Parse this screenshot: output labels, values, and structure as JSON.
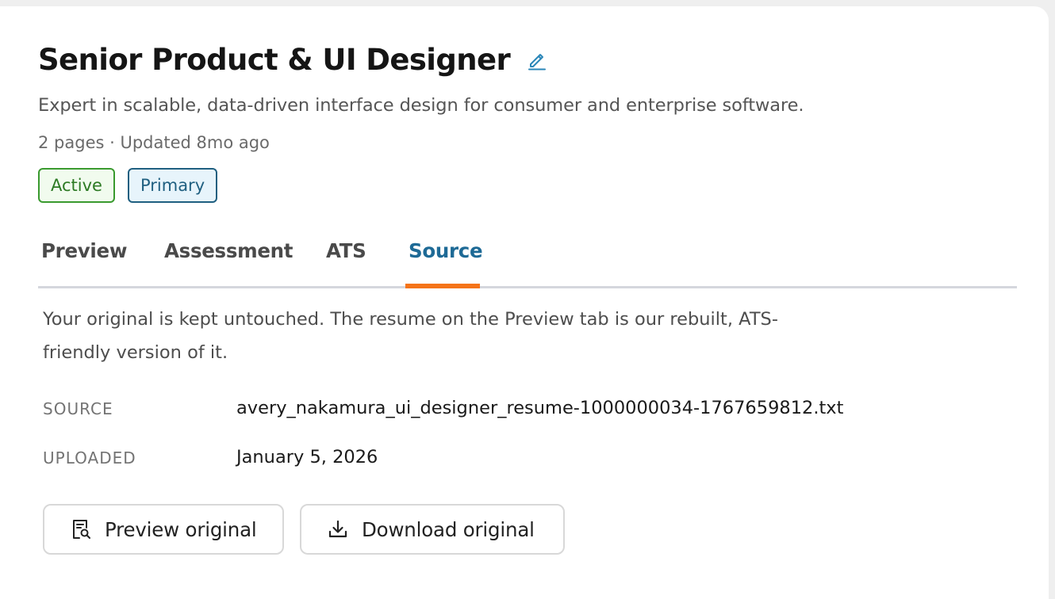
{
  "header": {
    "title": "Senior Product & UI Designer",
    "edit_icon": "pencil-icon",
    "subtitle": "Expert in scalable, data-driven interface design for consumer and enterprise software.",
    "meta": "2 pages · Updated 8mo ago"
  },
  "badges": {
    "active": "Active",
    "primary": "Primary"
  },
  "tabs": [
    {
      "label": "Preview",
      "active": false
    },
    {
      "label": "Assessment",
      "active": false
    },
    {
      "label": "ATS",
      "active": false
    },
    {
      "label": "Source",
      "active": true
    }
  ],
  "source_panel": {
    "description": "Your original is kept untouched. The resume on the Preview tab is our rebuilt, ATS-friendly version of it.",
    "source_label": "SOURCE",
    "source_value": "avery_nakamura_ui_designer_resume-1000000034-1767659812.txt",
    "uploaded_label": "UPLOADED",
    "uploaded_value": "January 5, 2026",
    "preview_button": "Preview original",
    "preview_icon": "document-search-icon",
    "download_button": "Download original",
    "download_icon": "download-icon"
  },
  "colors": {
    "accent_tab": "#1e6a96",
    "tab_underline": "#f57419",
    "active_badge": "#3a9a2f",
    "primary_badge": "#1f5f80"
  }
}
